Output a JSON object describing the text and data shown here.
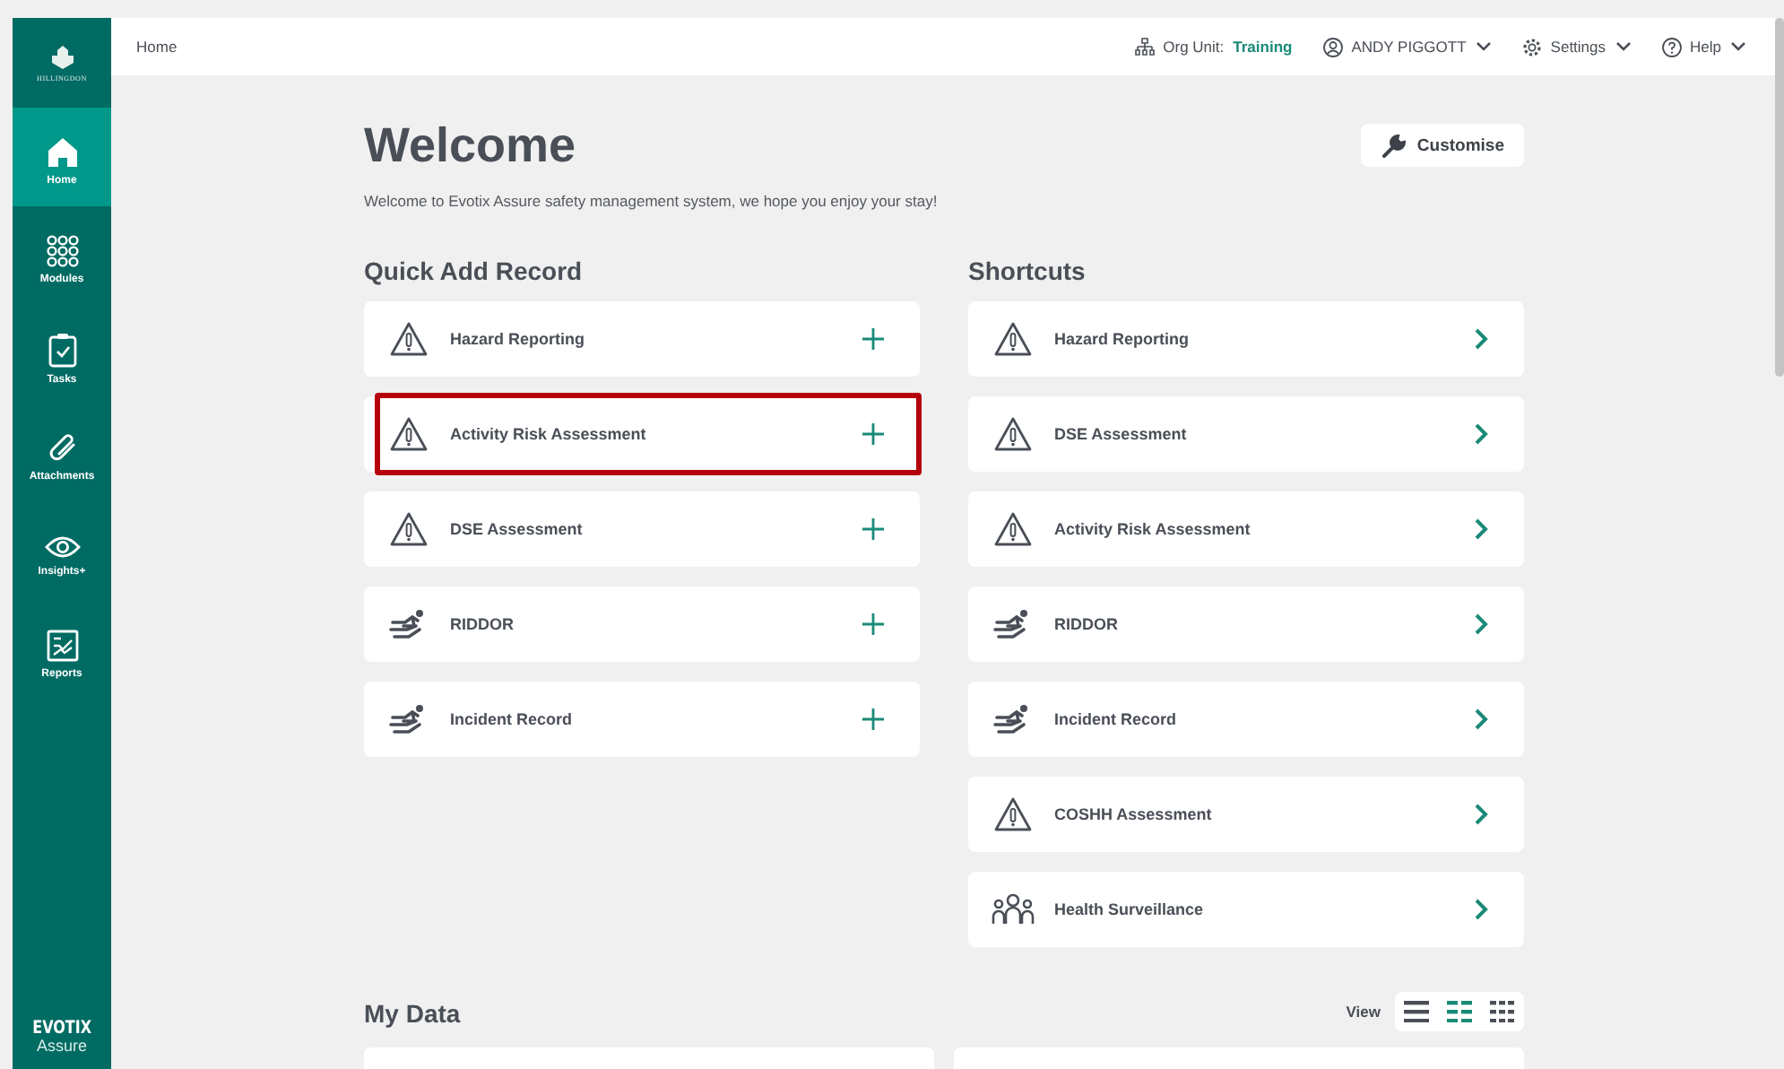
{
  "sidebar": {
    "logo_text": "HILLINGDON",
    "items": [
      {
        "label": "Home",
        "kind": "home",
        "selected": true
      },
      {
        "label": "Modules",
        "kind": "modules",
        "selected": false
      },
      {
        "label": "Tasks",
        "kind": "tasks",
        "selected": false
      },
      {
        "label": "Attachments",
        "kind": "attachments",
        "selected": false
      },
      {
        "label": "Insights+",
        "kind": "insights",
        "selected": false
      },
      {
        "label": "Reports",
        "kind": "reports",
        "selected": false
      }
    ],
    "brand": "EVOTIX",
    "brand_sub": "Assure"
  },
  "top_bar": {
    "breadcrumb": "Home",
    "org_unit_label": "Org Unit:",
    "org_unit": "Training",
    "user": "ANDY PIGGOTT",
    "settings": "Settings",
    "help": "Help"
  },
  "title": "Welcome",
  "customise_button": "Customise",
  "subtitle": "Welcome to Evotix Assure safety management system, we hope you enjoy your stay!",
  "quick_add": {
    "heading": "Quick Add Record",
    "items": [
      {
        "label": "Hazard Reporting",
        "kind": "hazard",
        "highlighted": false
      },
      {
        "label": "Activity Risk Assessment",
        "kind": "hazard",
        "highlighted": true
      },
      {
        "label": "DSE Assessment",
        "kind": "hazard",
        "highlighted": false
      },
      {
        "label": "RIDDOR",
        "kind": "injury",
        "highlighted": false
      },
      {
        "label": "Incident Record",
        "kind": "injury",
        "highlighted": false
      }
    ]
  },
  "shortcuts": {
    "heading": "Shortcuts",
    "items": [
      {
        "label": "Hazard Reporting",
        "kind": "hazard"
      },
      {
        "label": "DSE Assessment",
        "kind": "hazard"
      },
      {
        "label": "Activity Risk Assessment",
        "kind": "hazard"
      },
      {
        "label": "RIDDOR",
        "kind": "injury"
      },
      {
        "label": "Incident Record",
        "kind": "injury"
      },
      {
        "label": "COSHH Assessment",
        "kind": "hazard"
      },
      {
        "label": "Health Surveillance",
        "kind": "people"
      }
    ]
  },
  "my_data": {
    "heading": "My Data",
    "view_label": "View",
    "view_options": [
      {
        "kind": "list",
        "selected": false
      },
      {
        "kind": "columns",
        "selected": true
      },
      {
        "kind": "grid",
        "selected": false
      }
    ]
  }
}
